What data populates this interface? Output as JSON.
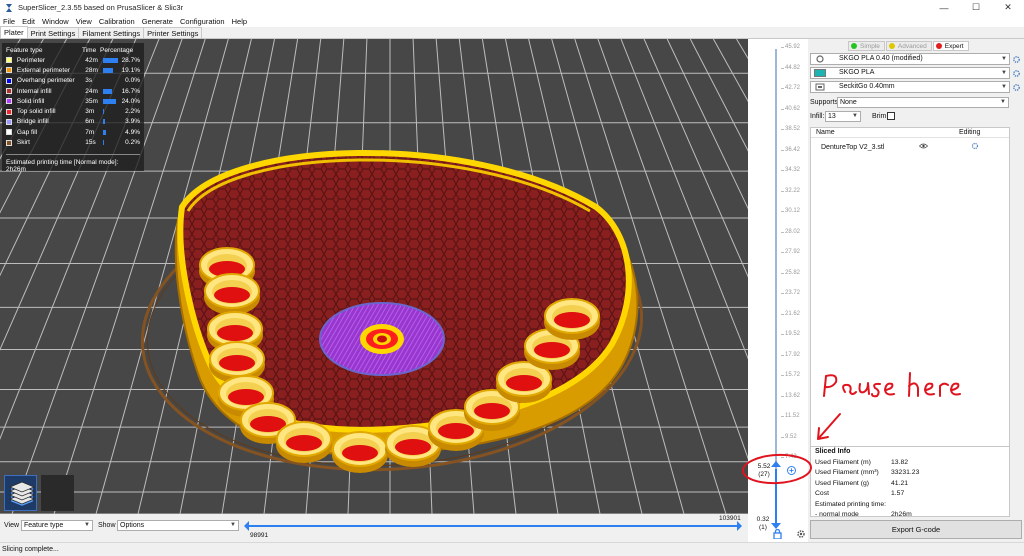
{
  "window": {
    "title": "SuperSlicer_2.3.55 based on PrusaSlicer & Slic3r",
    "controls": [
      "—",
      "☐",
      "✕"
    ]
  },
  "menu": [
    "File",
    "Edit",
    "Window",
    "View",
    "Calibration",
    "Generate",
    "Configuration",
    "Help"
  ],
  "tabs": [
    "Plater",
    "Print Settings",
    "Filament Settings",
    "Printer Settings"
  ],
  "legend": {
    "header": {
      "feature": "Feature type",
      "time": "Time",
      "percentage": "Percentage"
    },
    "rows": [
      {
        "name": "Perimeter",
        "time": "42m",
        "pct": "28.7%",
        "fraction": 0.287,
        "color": "#ffff66"
      },
      {
        "name": "External perimeter",
        "time": "28m",
        "pct": "19.1%",
        "fraction": 0.191,
        "color": "#ff9900"
      },
      {
        "name": "Overhang perimeter",
        "time": "3s",
        "pct": "0.0%",
        "fraction": 0.0,
        "color": "#0000ff"
      },
      {
        "name": "Internal infill",
        "time": "24m",
        "pct": "16.7%",
        "fraction": 0.167,
        "color": "#b03029"
      },
      {
        "name": "Solid infill",
        "time": "35m",
        "pct": "24.0%",
        "fraction": 0.24,
        "color": "#b03cff"
      },
      {
        "name": "Top solid infill",
        "time": "3m",
        "pct": "2.2%",
        "fraction": 0.022,
        "color": "#ff2222"
      },
      {
        "name": "Bridge infill",
        "time": "6m",
        "pct": "3.9%",
        "fraction": 0.039,
        "color": "#9999ff"
      },
      {
        "name": "Gap fill",
        "time": "7m",
        "pct": "4.9%",
        "fraction": 0.049,
        "color": "#ffffff"
      },
      {
        "name": "Skirt",
        "time": "15s",
        "pct": "0.2%",
        "fraction": 0.002,
        "color": "#845321"
      }
    ],
    "estimated": "Estimated printing time [Normal mode]:",
    "estimated_value": "2h26m"
  },
  "bottom": {
    "view_label": "View",
    "view_value": "Feature type",
    "show_label": "Show",
    "show_value": "Options",
    "h_max": "103901",
    "h_min": "98991"
  },
  "status": "Slicing complete...",
  "vslider": {
    "ticks": [
      "45.92",
      "44.82",
      "42.72",
      "40.62",
      "38.52",
      "36.42",
      "34.32",
      "32.22",
      "30.12",
      "28.02",
      "27.92",
      "25.82",
      "23.72",
      "21.62",
      "19.52",
      "17.92",
      "15.72",
      "13.62",
      "11.52",
      "9.52",
      "7.42"
    ],
    "top_value": "5.52",
    "top_layer": "(27)",
    "bottom_value": "0.32",
    "bottom_layer": "(1)"
  },
  "sidebar": {
    "modes": [
      {
        "label": "Simple",
        "color": "#22c422",
        "active": false
      },
      {
        "label": "Advanced",
        "color": "#e0c800",
        "active": false
      },
      {
        "label": "Expert",
        "color": "#e02020",
        "active": true
      }
    ],
    "presets": [
      {
        "value": "SKGO PLA 0.40 (modified)",
        "icon": "print-settings-icon"
      },
      {
        "value": "SKGO PLA",
        "icon": "filament-color-swatch",
        "color": "#1cb3b3"
      },
      {
        "value": "SeckitGo 0.40mm",
        "icon": "printer-icon"
      }
    ],
    "supports_label": "Supports:",
    "supports_value": "None",
    "infill_label": "Infill:",
    "infill_value": "13",
    "brim_label": "Brim:",
    "objects_header": {
      "name": "Name",
      "editing": "Editing"
    },
    "objects": [
      {
        "name": "DentureTop V2_3.stl"
      }
    ],
    "sliced_info": {
      "title": "Sliced Info",
      "rows": [
        {
          "key": "Used Filament (m)",
          "value": "13.82"
        },
        {
          "key": "Used Filament (mm³)",
          "value": "33231.23"
        },
        {
          "key": "Used Filament (g)",
          "value": "41.21"
        },
        {
          "key": "Cost",
          "value": "1.57"
        },
        {
          "key": "Estimated printing time:",
          "value": ""
        },
        {
          "key": "- normal mode",
          "value": "2h26m"
        }
      ]
    },
    "export_label": "Export G-code"
  },
  "annotation": {
    "text": "Pause here",
    "color": "#e0141e"
  }
}
